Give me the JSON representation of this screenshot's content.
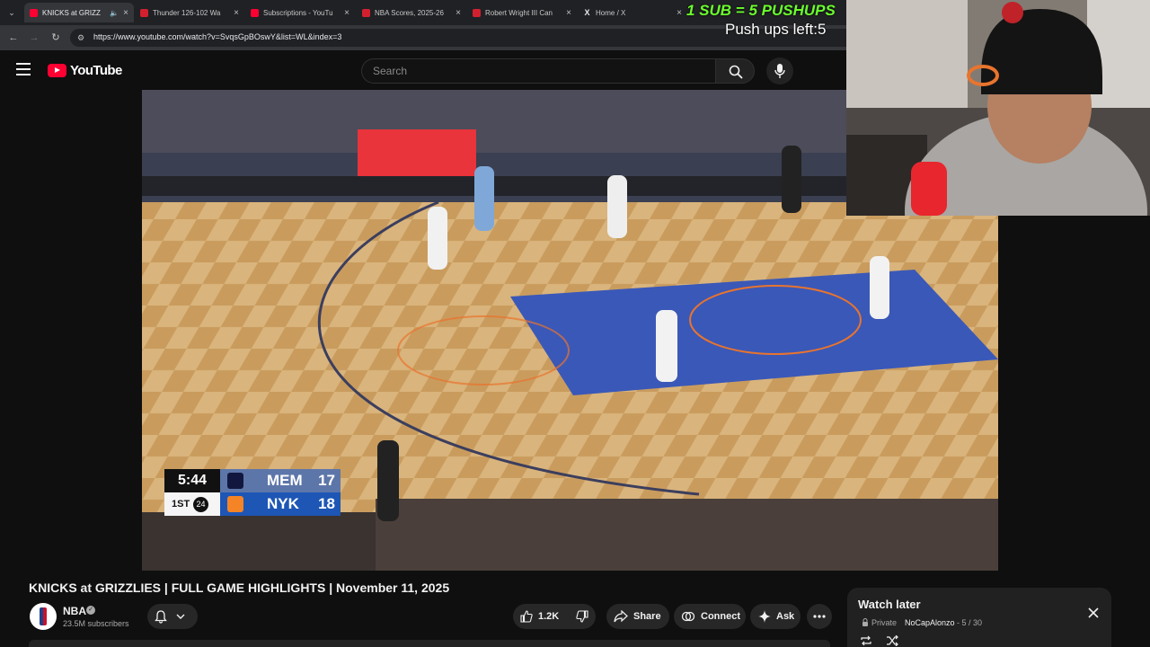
{
  "browser": {
    "tabs": [
      {
        "title": "KNICKS at GRIZZ",
        "favicon": "youtube-icon",
        "active": true,
        "audio": true
      },
      {
        "title": "Thunder 126-102 Wa",
        "favicon": "nba-icon",
        "active": false
      },
      {
        "title": "Subscriptions - YouTu",
        "favicon": "youtube-icon",
        "active": false
      },
      {
        "title": "NBA Scores, 2025-26",
        "favicon": "nba-icon",
        "active": false
      },
      {
        "title": "Robert Wright III Can",
        "favicon": "nba-icon",
        "active": false
      },
      {
        "title": "Home / X",
        "favicon": "x-icon",
        "active": false
      }
    ],
    "url": "https://www.youtube.com/watch?v=SvqsGpBOswY&list=WL&index=3"
  },
  "masthead": {
    "logo_text": "YouTube",
    "search_placeholder": "Search"
  },
  "overlay": {
    "pushups_title": "1 SUB = 5 PUSHUPS",
    "pushups_left": "Push ups left:5"
  },
  "scorebug": {
    "clock": "5:44",
    "period": "1ST",
    "shot_clock": "24",
    "teams": [
      {
        "abbr": "MEM",
        "score": "17",
        "color": "#5d76a9"
      },
      {
        "abbr": "NYK",
        "score": "18",
        "color": "#1d56b5"
      }
    ]
  },
  "video": {
    "title": "KNICKS at GRIZZLIES | FULL GAME HIGHLIGHTS | November 11, 2025",
    "channel": "NBA",
    "subscribers": "23.5M subscribers",
    "likes": "1.2K",
    "share_label": "Share",
    "connect_label": "Connect",
    "ask_label": "Ask"
  },
  "watch_later": {
    "title": "Watch later",
    "privacy": "Private",
    "owner": "NoCapAlonzo",
    "position": "- 5 / 30"
  },
  "colors": {
    "youtube_red": "#ff0033",
    "overlay_green": "#6bff2e",
    "background": "#0f0f0f"
  }
}
